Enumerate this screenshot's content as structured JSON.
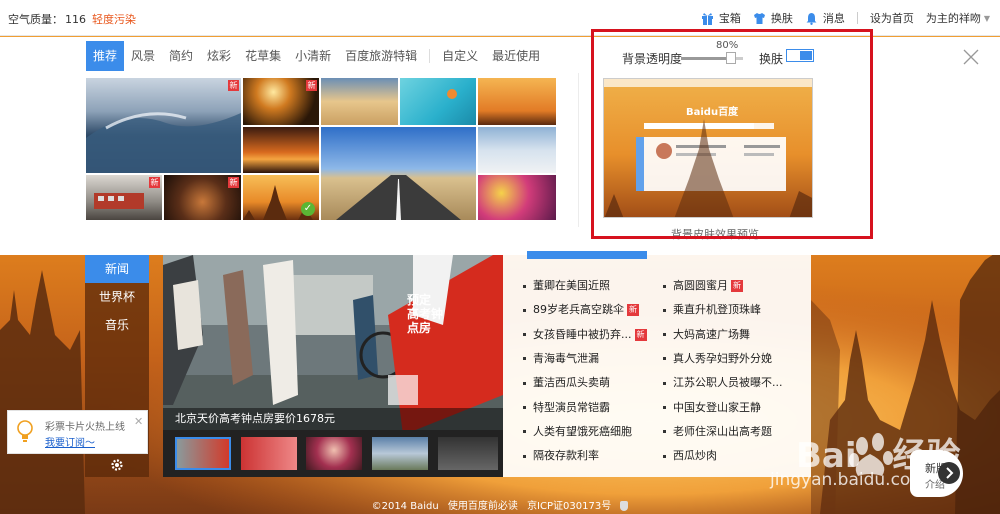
{
  "topbar": {
    "air_label": "空气质量：",
    "air_value": "116",
    "air_level": "轻度污染",
    "links": [
      {
        "label": "宝箱",
        "icon": "gift-icon"
      },
      {
        "label": "换肤",
        "icon": "tshirt-icon"
      },
      {
        "label": "消息",
        "icon": "bell-icon"
      }
    ],
    "set_home": "设为首页",
    "user": "为主的祥吻"
  },
  "skin_panel": {
    "tabs": [
      "推荐",
      "风景",
      "简约",
      "炫彩",
      "花草集",
      "小清新",
      "百度旅游特辑",
      "自定义",
      "最近使用"
    ],
    "active_tab": "推荐",
    "new_badge": "新",
    "opacity_label": "背景透明度",
    "opacity_value": "80%",
    "opacity_fraction": 0.8,
    "skin_label": "换肤",
    "preview_caption": "背景皮肤效果预览",
    "preview_logo": "Baidu百度",
    "close_icon": "close-icon",
    "highlight_color": "#d6121e"
  },
  "left_nav": {
    "items": [
      "新闻",
      "世界杯",
      "音乐"
    ],
    "active": "新闻"
  },
  "news": {
    "caption": "北京天价高考钟点房要价1678元",
    "sign_text": "预定 高考钟点房",
    "headlines_left": [
      {
        "text": "董卿在美国近照",
        "new": false
      },
      {
        "text": "89岁老兵高空跳伞",
        "new": true
      },
      {
        "text": "女孩昏睡中被扔弃...",
        "new": true
      },
      {
        "text": "青海毒气泄漏",
        "new": false
      },
      {
        "text": "董洁西瓜头卖萌",
        "new": false
      },
      {
        "text": "特型演员常铠霸",
        "new": false
      },
      {
        "text": "人类有望饿死癌细胞",
        "new": false
      },
      {
        "text": "隔夜存款利率",
        "new": false
      }
    ],
    "headlines_right": [
      {
        "text": "高圆圆蜜月",
        "new": true
      },
      {
        "text": "乘直升机登顶珠峰",
        "new": false
      },
      {
        "text": "大妈高速广场舞",
        "new": false
      },
      {
        "text": "真人秀孕妇野外分娩",
        "new": false
      },
      {
        "text": "江苏公职人员被曝不...",
        "new": false
      },
      {
        "text": "中国女登山家王静",
        "new": false
      },
      {
        "text": "老师住深山出高考题",
        "new": false
      },
      {
        "text": "西瓜炒肉",
        "new": false
      }
    ]
  },
  "lottery": {
    "title": "彩票卡片火热上线",
    "link": "我要订阅～"
  },
  "footer": {
    "copyright": "©2014  Baidu",
    "terms": "使用百度前必读",
    "icp": "京ICP证030173号"
  },
  "watermark": {
    "brand": "Bai",
    "brand2": "经验",
    "url": "jingyan.baidu.com",
    "new_version": "新版",
    "new_version_sub": "介绍"
  },
  "colors": {
    "accent": "#3b8cea",
    "alert": "#e8561b",
    "new_badge": "#e4393c"
  }
}
